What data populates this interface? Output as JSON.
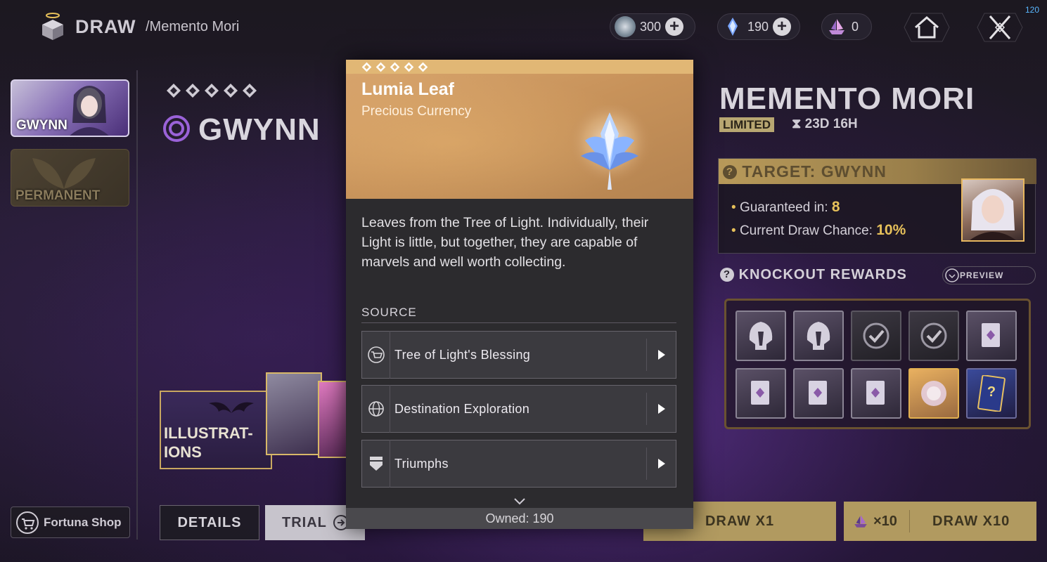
{
  "header": {
    "title": "DRAW",
    "subtitle": "/Memento Mori",
    "currencies": [
      {
        "icon": "glimmer-coin-icon",
        "value": "300"
      },
      {
        "icon": "lumia-leaf-icon",
        "value": "190"
      },
      {
        "icon": "ship-token-icon",
        "value": "0"
      }
    ],
    "fps": "120"
  },
  "sidebar": {
    "banners": [
      {
        "label": "GWYNN"
      },
      {
        "label": "PERMANENT"
      }
    ],
    "fortuna_shop": "Fortuna Shop"
  },
  "character": {
    "name": "GWYNN",
    "rarity_stars": 5,
    "illustrations_label": "ILLUSTRAT-\nIONS",
    "details_label": "DETAILS",
    "trial_label": "TRIAL"
  },
  "banner_info": {
    "title": "MEMENTO MORI",
    "badge": "LIMITED",
    "timer": "23D 16H",
    "target_title": "TARGET: GWYNN",
    "guaranteed_label": "Guaranteed in:",
    "guaranteed_value": "8",
    "chance_label": "Current Draw Chance:",
    "chance_value": "10%",
    "knockout_title": "KNOCKOUT REWARDS",
    "preview_label": "PREVIEW",
    "knockout_items": [
      {
        "icon": "helmet-icon",
        "state": "available"
      },
      {
        "icon": "helmet-icon",
        "state": "available"
      },
      {
        "icon": "check-icon",
        "state": "claimed"
      },
      {
        "icon": "check-icon",
        "state": "claimed"
      },
      {
        "icon": "card-icon",
        "state": "available"
      },
      {
        "icon": "card-icon",
        "state": "available"
      },
      {
        "icon": "card-icon",
        "state": "available"
      },
      {
        "icon": "card-icon",
        "state": "available"
      },
      {
        "icon": "orb-icon",
        "state": "special"
      },
      {
        "icon": "mystery-pack-icon",
        "state": "special"
      }
    ],
    "draw_x1": "DRAW X1",
    "draw_x10_cost": "×10",
    "draw_x10": "DRAW X10"
  },
  "popup": {
    "rarity_stars": 5,
    "item_name": "Lumia Leaf",
    "item_type": "Precious Currency",
    "description": "Leaves from the Tree of Light. Individually, their Light is little, but together, they are capable of marvels and well worth collecting.",
    "source_label": "SOURCE",
    "sources": [
      {
        "icon": "blessing-icon",
        "label": "Tree of Light's Blessing"
      },
      {
        "icon": "globe-icon",
        "label": "Destination Exploration"
      },
      {
        "icon": "shield-icon",
        "label": "Triumphs"
      }
    ],
    "owned": "Owned: 190"
  },
  "colors": {
    "gold": "#b19a60",
    "highlight": "#e6c05a",
    "popup_header": "#d9a66e"
  }
}
